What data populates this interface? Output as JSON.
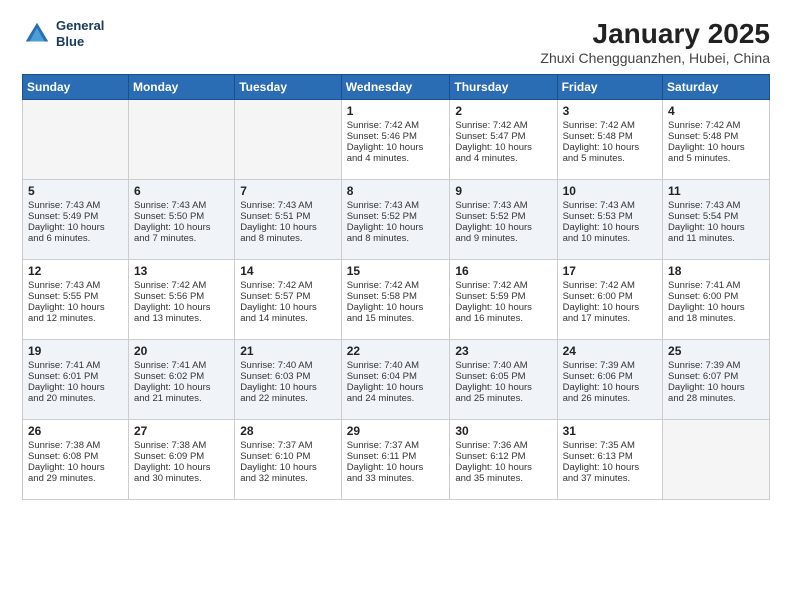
{
  "header": {
    "logo_line1": "General",
    "logo_line2": "Blue",
    "title": "January 2025",
    "subtitle": "Zhuxi Chengguanzhen, Hubei, China"
  },
  "weekdays": [
    "Sunday",
    "Monday",
    "Tuesday",
    "Wednesday",
    "Thursday",
    "Friday",
    "Saturday"
  ],
  "weeks": [
    [
      {
        "num": "",
        "info": ""
      },
      {
        "num": "",
        "info": ""
      },
      {
        "num": "",
        "info": ""
      },
      {
        "num": "1",
        "info": "Sunrise: 7:42 AM\nSunset: 5:46 PM\nDaylight: 10 hours\nand 4 minutes."
      },
      {
        "num": "2",
        "info": "Sunrise: 7:42 AM\nSunset: 5:47 PM\nDaylight: 10 hours\nand 4 minutes."
      },
      {
        "num": "3",
        "info": "Sunrise: 7:42 AM\nSunset: 5:48 PM\nDaylight: 10 hours\nand 5 minutes."
      },
      {
        "num": "4",
        "info": "Sunrise: 7:42 AM\nSunset: 5:48 PM\nDaylight: 10 hours\nand 5 minutes."
      }
    ],
    [
      {
        "num": "5",
        "info": "Sunrise: 7:43 AM\nSunset: 5:49 PM\nDaylight: 10 hours\nand 6 minutes."
      },
      {
        "num": "6",
        "info": "Sunrise: 7:43 AM\nSunset: 5:50 PM\nDaylight: 10 hours\nand 7 minutes."
      },
      {
        "num": "7",
        "info": "Sunrise: 7:43 AM\nSunset: 5:51 PM\nDaylight: 10 hours\nand 8 minutes."
      },
      {
        "num": "8",
        "info": "Sunrise: 7:43 AM\nSunset: 5:52 PM\nDaylight: 10 hours\nand 8 minutes."
      },
      {
        "num": "9",
        "info": "Sunrise: 7:43 AM\nSunset: 5:52 PM\nDaylight: 10 hours\nand 9 minutes."
      },
      {
        "num": "10",
        "info": "Sunrise: 7:43 AM\nSunset: 5:53 PM\nDaylight: 10 hours\nand 10 minutes."
      },
      {
        "num": "11",
        "info": "Sunrise: 7:43 AM\nSunset: 5:54 PM\nDaylight: 10 hours\nand 11 minutes."
      }
    ],
    [
      {
        "num": "12",
        "info": "Sunrise: 7:43 AM\nSunset: 5:55 PM\nDaylight: 10 hours\nand 12 minutes."
      },
      {
        "num": "13",
        "info": "Sunrise: 7:42 AM\nSunset: 5:56 PM\nDaylight: 10 hours\nand 13 minutes."
      },
      {
        "num": "14",
        "info": "Sunrise: 7:42 AM\nSunset: 5:57 PM\nDaylight: 10 hours\nand 14 minutes."
      },
      {
        "num": "15",
        "info": "Sunrise: 7:42 AM\nSunset: 5:58 PM\nDaylight: 10 hours\nand 15 minutes."
      },
      {
        "num": "16",
        "info": "Sunrise: 7:42 AM\nSunset: 5:59 PM\nDaylight: 10 hours\nand 16 minutes."
      },
      {
        "num": "17",
        "info": "Sunrise: 7:42 AM\nSunset: 6:00 PM\nDaylight: 10 hours\nand 17 minutes."
      },
      {
        "num": "18",
        "info": "Sunrise: 7:41 AM\nSunset: 6:00 PM\nDaylight: 10 hours\nand 18 minutes."
      }
    ],
    [
      {
        "num": "19",
        "info": "Sunrise: 7:41 AM\nSunset: 6:01 PM\nDaylight: 10 hours\nand 20 minutes."
      },
      {
        "num": "20",
        "info": "Sunrise: 7:41 AM\nSunset: 6:02 PM\nDaylight: 10 hours\nand 21 minutes."
      },
      {
        "num": "21",
        "info": "Sunrise: 7:40 AM\nSunset: 6:03 PM\nDaylight: 10 hours\nand 22 minutes."
      },
      {
        "num": "22",
        "info": "Sunrise: 7:40 AM\nSunset: 6:04 PM\nDaylight: 10 hours\nand 24 minutes."
      },
      {
        "num": "23",
        "info": "Sunrise: 7:40 AM\nSunset: 6:05 PM\nDaylight: 10 hours\nand 25 minutes."
      },
      {
        "num": "24",
        "info": "Sunrise: 7:39 AM\nSunset: 6:06 PM\nDaylight: 10 hours\nand 26 minutes."
      },
      {
        "num": "25",
        "info": "Sunrise: 7:39 AM\nSunset: 6:07 PM\nDaylight: 10 hours\nand 28 minutes."
      }
    ],
    [
      {
        "num": "26",
        "info": "Sunrise: 7:38 AM\nSunset: 6:08 PM\nDaylight: 10 hours\nand 29 minutes."
      },
      {
        "num": "27",
        "info": "Sunrise: 7:38 AM\nSunset: 6:09 PM\nDaylight: 10 hours\nand 30 minutes."
      },
      {
        "num": "28",
        "info": "Sunrise: 7:37 AM\nSunset: 6:10 PM\nDaylight: 10 hours\nand 32 minutes."
      },
      {
        "num": "29",
        "info": "Sunrise: 7:37 AM\nSunset: 6:11 PM\nDaylight: 10 hours\nand 33 minutes."
      },
      {
        "num": "30",
        "info": "Sunrise: 7:36 AM\nSunset: 6:12 PM\nDaylight: 10 hours\nand 35 minutes."
      },
      {
        "num": "31",
        "info": "Sunrise: 7:35 AM\nSunset: 6:13 PM\nDaylight: 10 hours\nand 37 minutes."
      },
      {
        "num": "",
        "info": ""
      }
    ]
  ]
}
